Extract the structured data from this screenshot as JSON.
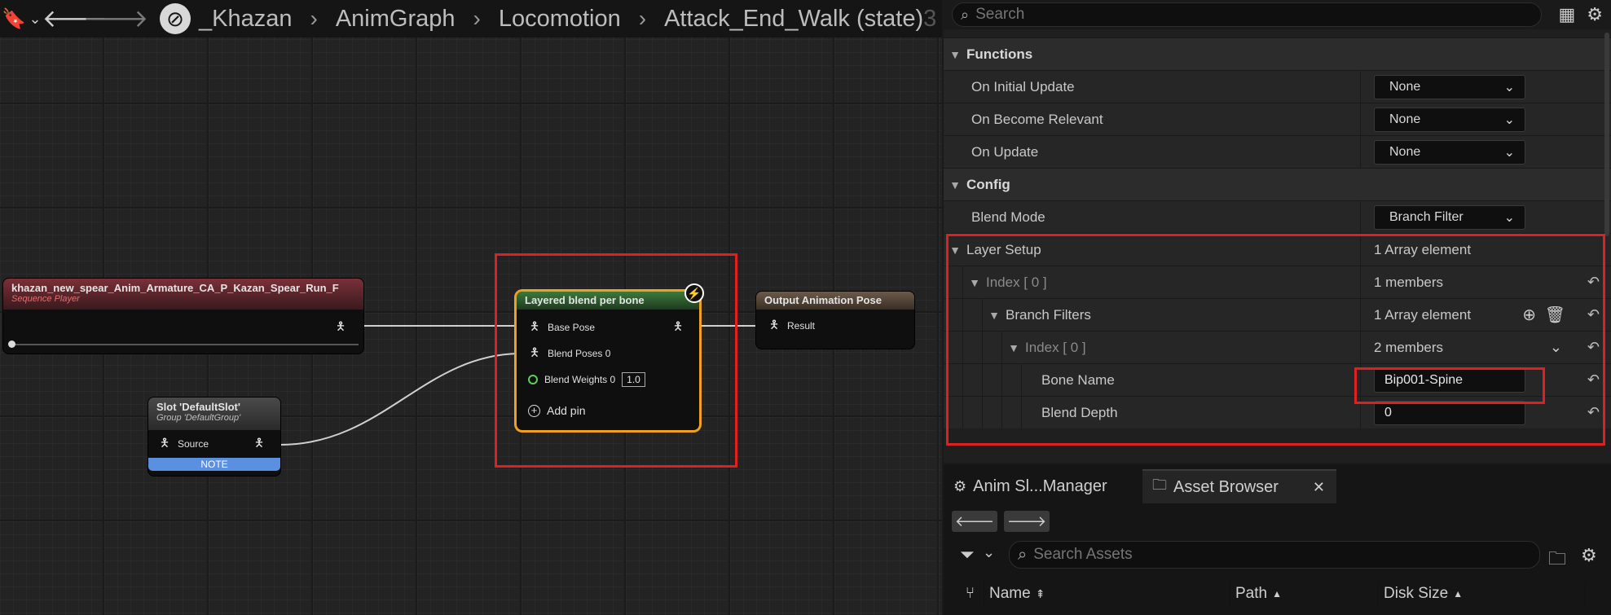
{
  "breadcrumb": {
    "items": [
      "_Khazan",
      "AnimGraph",
      "Locomotion",
      "Attack_End_Walk (state)"
    ],
    "overflow_count": "3"
  },
  "nodes": {
    "sequence_player": {
      "title": "khazan_new_spear_Anim_Armature_CA_P_Kazan_Spear_Run_F",
      "subtitle": "Sequence Player"
    },
    "slot": {
      "title": "Slot 'DefaultSlot'",
      "subtitle": "Group 'DefaultGroup'",
      "pin": "Source",
      "note": "NOTE"
    },
    "layered_blend": {
      "title": "Layered blend per bone",
      "pins": [
        "Base Pose",
        "Blend Poses 0",
        "Blend Weights 0"
      ],
      "weight_value": "1.0",
      "add_pin": "Add pin"
    },
    "output": {
      "title": "Output Animation Pose",
      "pin": "Result"
    }
  },
  "details": {
    "search_placeholder": "Search",
    "sections": {
      "functions": "Functions",
      "config": "Config"
    },
    "functions": [
      {
        "name": "On Initial Update",
        "value": "None"
      },
      {
        "name": "On Become Relevant",
        "value": "None"
      },
      {
        "name": "On Update",
        "value": "None"
      }
    ],
    "blend_mode": {
      "name": "Blend Mode",
      "value": "Branch Filter"
    },
    "layer_setup": {
      "name": "Layer Setup",
      "value": "1 Array element"
    },
    "index0": {
      "name": "Index [ 0 ]",
      "value": "1 members"
    },
    "branch_filters": {
      "name": "Branch Filters",
      "value": "1 Array element"
    },
    "index0_inner": {
      "name": "Index [ 0 ]",
      "value": "2 members"
    },
    "bone_name": {
      "name": "Bone Name",
      "value": "Bip001-Spine"
    },
    "blend_depth": {
      "name": "Blend Depth",
      "value": "0"
    }
  },
  "assets": {
    "tabs": [
      "Anim Sl...Manager",
      "Asset Browser"
    ],
    "search_placeholder": "Search Assets",
    "columns": [
      "Name",
      "Path",
      "Disk Size"
    ]
  },
  "colors": {
    "highlight_red": "#e02020",
    "sequence_header": "#6a2a2f",
    "blend_header": "#2f5a2f",
    "output_header": "#5a4a3a",
    "note_blue": "#5b8fe0",
    "selection_orange": "#f0a020"
  }
}
